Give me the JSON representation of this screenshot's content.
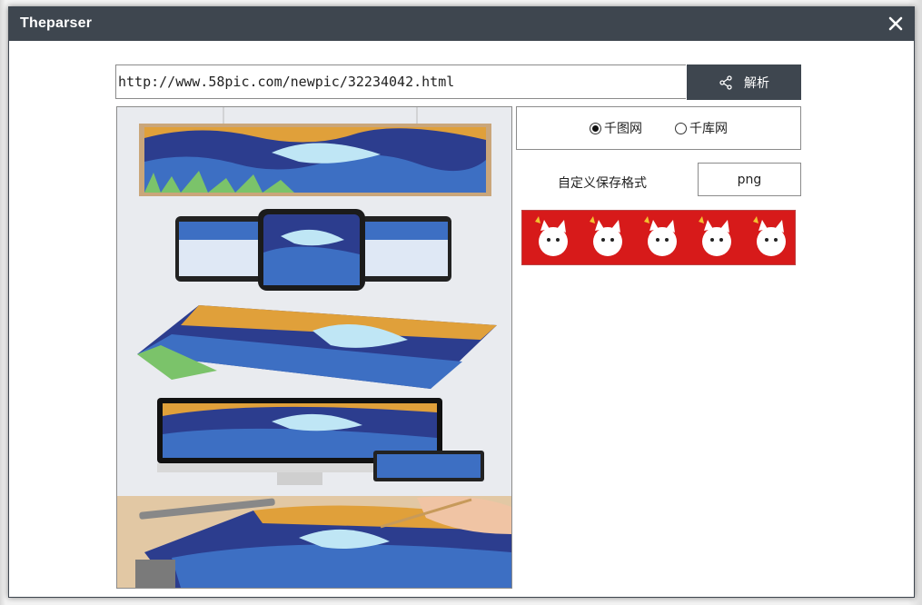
{
  "window": {
    "title": "Theparser"
  },
  "toolbar": {
    "url_value": "http://www.58pic.com/newpic/32234042.html",
    "parse_label": "解析"
  },
  "source": {
    "options": [
      {
        "label": "千图网",
        "selected": true
      },
      {
        "label": "千库网",
        "selected": false
      }
    ]
  },
  "save_format": {
    "label": "自定义保存格式",
    "value": "png"
  },
  "icons": {
    "close": "close-icon",
    "share": "share-icon"
  },
  "colors": {
    "titlebar": "#3e464f",
    "button": "#3e464f",
    "sticker_bg": "#d71a1a"
  }
}
